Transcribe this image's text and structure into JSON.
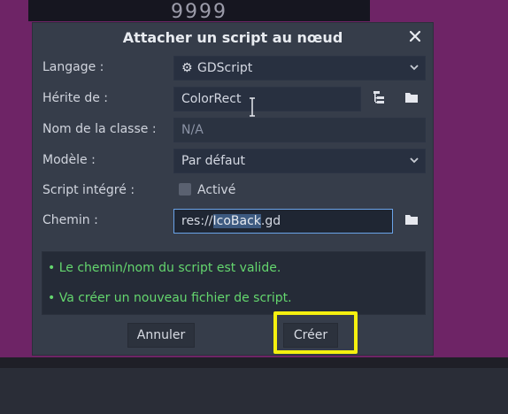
{
  "background": {
    "digits": "9999"
  },
  "dialog": {
    "title": "Attacher un script au nœud",
    "close_icon": "close-icon",
    "fields": {
      "language": {
        "label": "Langage :",
        "value": "GDScript",
        "icon": "gear-icon"
      },
      "inherits": {
        "label": "Hérite de :",
        "value": "ColorRect"
      },
      "class_name": {
        "label": "Nom de la classe :",
        "value": "N/A"
      },
      "template": {
        "label": "Modèle :",
        "value": "Par défaut"
      },
      "builtin": {
        "label": "Script intégré :",
        "checkbox_label": "Activé",
        "checked": false
      },
      "path": {
        "label": "Chemin :",
        "value_prefix": "res://",
        "value_selected": "IcoBack",
        "value_suffix": ".gd"
      }
    },
    "info": {
      "lines": [
        "• Le chemin/nom du script est valide.",
        "• Va créer un nouveau fichier de script."
      ],
      "color": "#64d66e"
    },
    "buttons": {
      "cancel": "Annuler",
      "create": "Créer"
    }
  },
  "colors": {
    "highlight": "#f5f00f",
    "selection": "#3d5a80",
    "focus_border": "#6aa3e8"
  }
}
